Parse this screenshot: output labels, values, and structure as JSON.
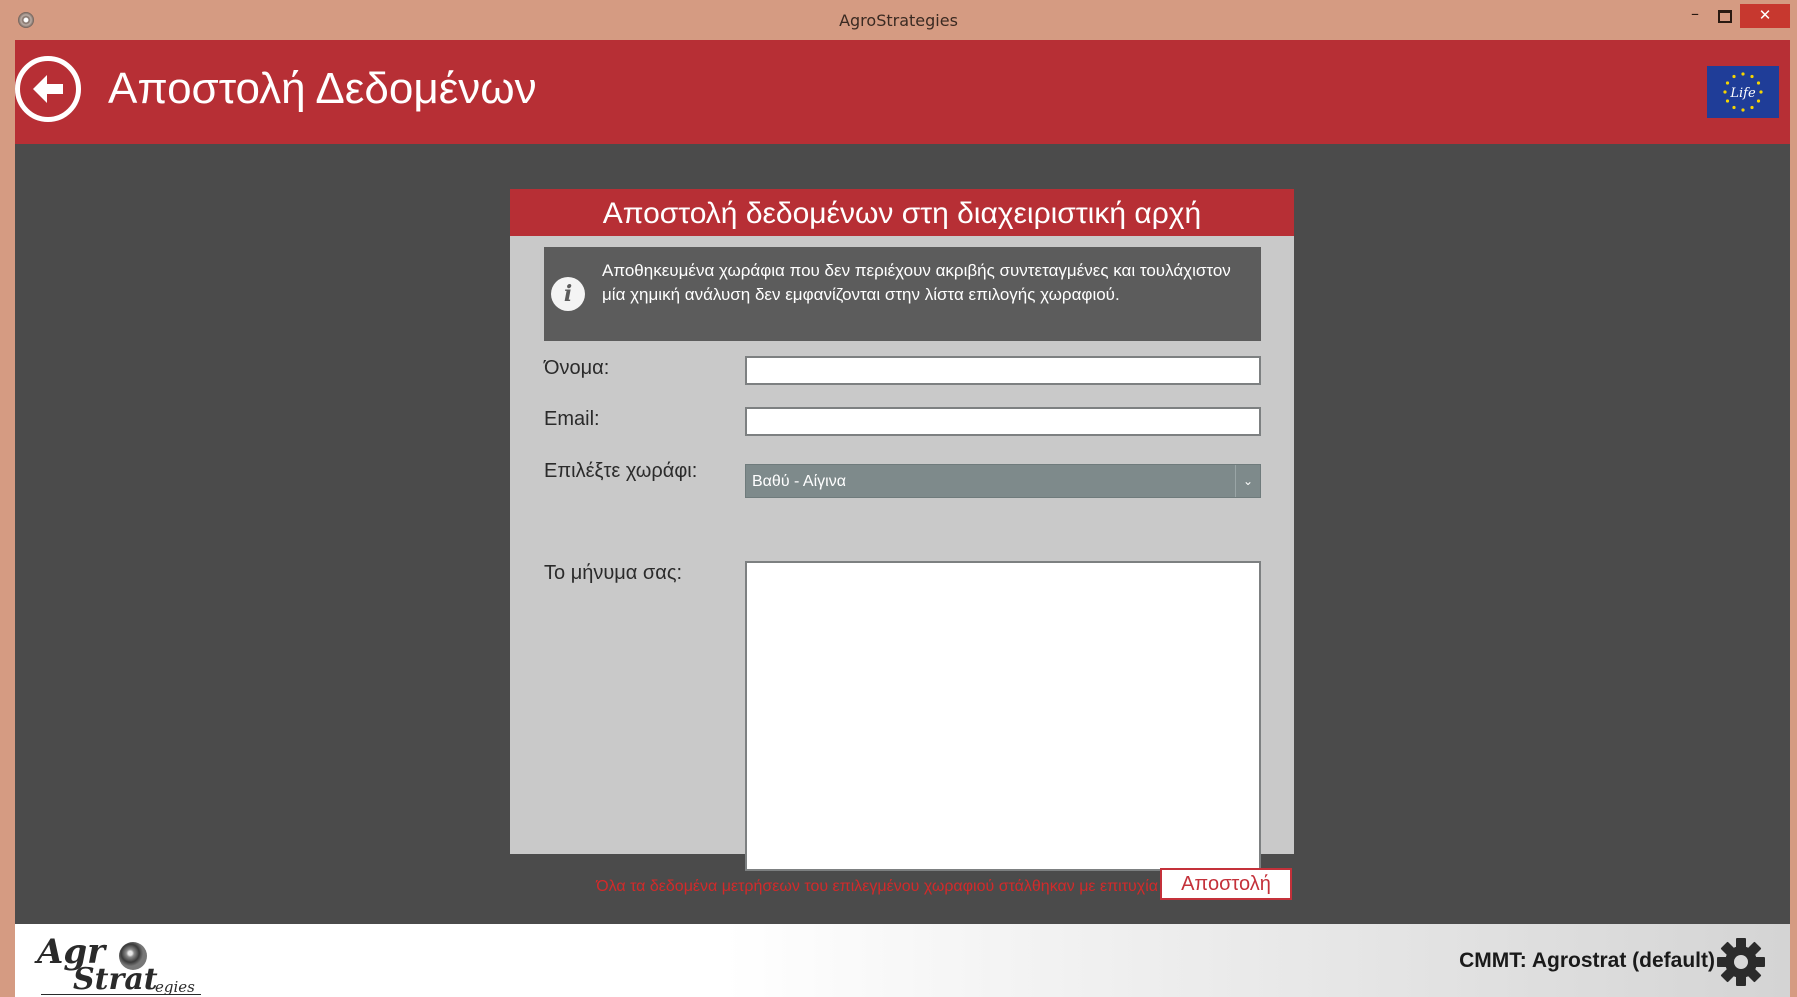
{
  "window": {
    "title": "AgroStrategies",
    "minimize_glyph": "–",
    "close_glyph": "✕"
  },
  "header": {
    "title": "Αποστολή Δεδομένων",
    "back_icon": "back-arrow-icon",
    "logo_text": "Life"
  },
  "panel": {
    "title": "Αποστολή δεδομένων στη διαχειριστική αρχή",
    "info": {
      "icon": "info-icon",
      "icon_glyph": "i",
      "text": "Αποθηκευμένα χωράφια που δεν περιέχουν ακριβής συντεταγμένες και τουλάχιστον μία χημική ανάλυση δεν εμφανίζονται στην λίστα επιλογής χωραφιού."
    },
    "fields": {
      "name_label": "Όνομα:",
      "name_value": "",
      "email_label": "Email:",
      "email_value": "",
      "field_label": "Επιλέξτε χωράφι:",
      "field_selected": "Βαθύ - Αίγινα",
      "message_label": "Το μήνυμα σας:",
      "message_value": ""
    }
  },
  "actions": {
    "status_text": "Όλα τα δεδομένα μετρήσεων του επιλεγμένου χωραφιού στάλθηκαν με επιτυχία",
    "send_label": "Αποστολή"
  },
  "footer": {
    "logo_agr": "Agr",
    "logo_strat": "Strat",
    "logo_egies": "egies",
    "cmmt": "CMMT: Agrostrat (default)",
    "settings_icon": "gear-icon"
  },
  "colors": {
    "accent": "#b72f35",
    "background": "#4b4b4b",
    "panel": "#c9c9c9",
    "title_bar": "#d59b82",
    "status": "#d22a2a"
  }
}
